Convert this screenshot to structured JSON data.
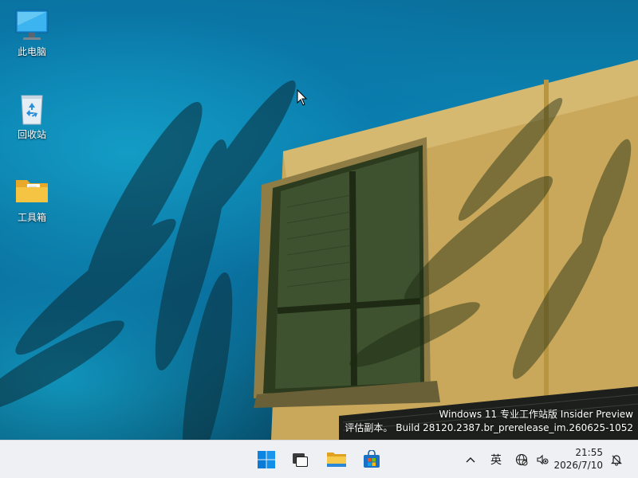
{
  "desktop": {
    "icons": [
      {
        "label": "此电脑",
        "icon": "monitor-icon"
      },
      {
        "label": "回收站",
        "icon": "recycle-bin-icon"
      },
      {
        "label": "工具箱",
        "icon": "folder-icon"
      }
    ]
  },
  "watermark": {
    "line1": "Windows 11 专业工作站版 Insider Preview",
    "line2": "评估副本。 Build 28120.2387.br_prerelease_im.260625-1052"
  },
  "taskbar": {
    "apps": [
      {
        "name": "start",
        "icon": "windows-logo-icon"
      },
      {
        "name": "task-view",
        "icon": "task-view-icon"
      },
      {
        "name": "file-explorer",
        "icon": "file-explorer-icon"
      },
      {
        "name": "store",
        "icon": "store-icon"
      }
    ],
    "tray": {
      "chevron": "^",
      "ime_label": "英",
      "network_icon": "globe-network-icon",
      "volume_icon": "speaker-muted-icon",
      "notification_icon": "notification-bell-icon"
    },
    "clock": {
      "time": "21:55",
      "date": "2026/7/10"
    }
  },
  "colors": {
    "taskbar_bg": "#eef0f3",
    "windows_blue": "#0078d4",
    "folder_yellow": "#f6c443"
  }
}
